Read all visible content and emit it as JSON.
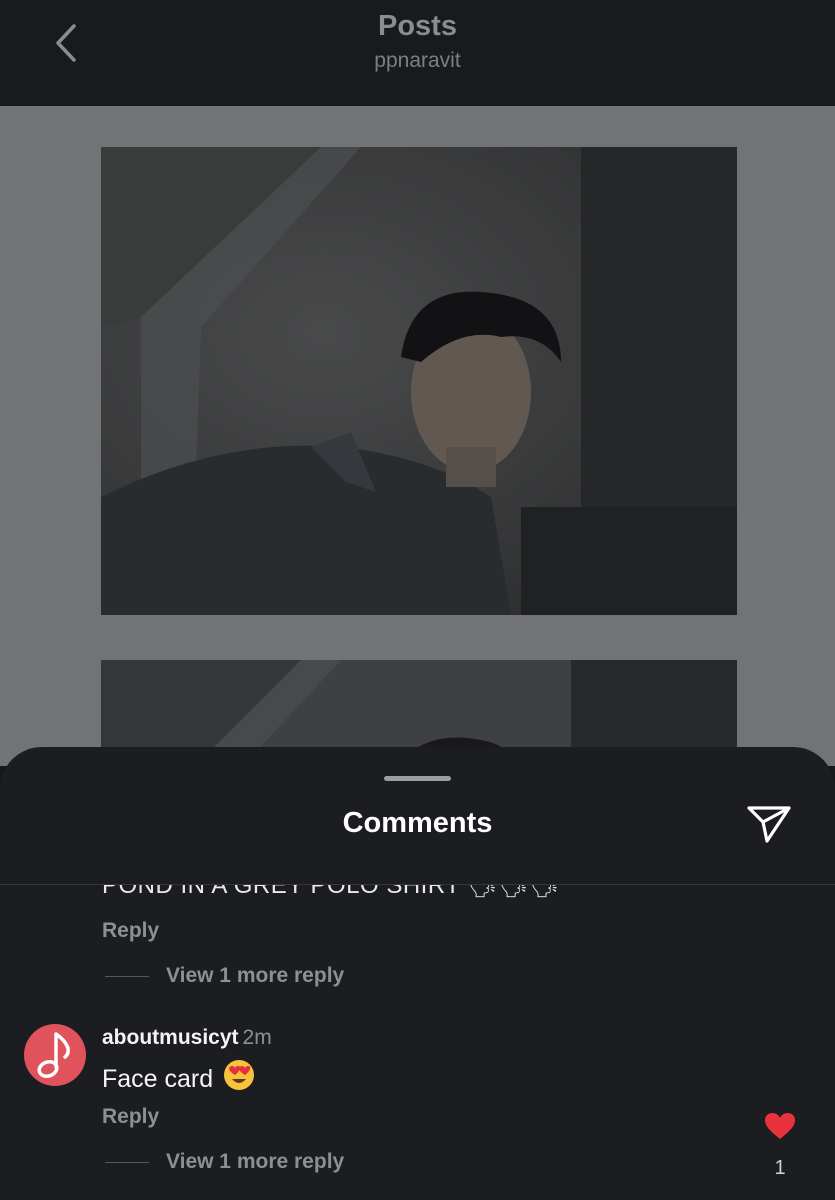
{
  "header": {
    "title": "Posts",
    "subtitle": "ppnaravit",
    "back_icon": "chevron-left-icon"
  },
  "feed": {
    "photos": [
      "post-photo-1",
      "post-photo-2"
    ]
  },
  "sheet": {
    "title": "Comments",
    "share_icon": "paper-plane-icon"
  },
  "comments": [
    {
      "text_partial": "POND IN A GREY POLO SHIRT 🗣🗣🗣",
      "reply_label": "Reply",
      "view_more_label": "View 1 more reply"
    },
    {
      "username": "aboutmusicyt",
      "time": "2m",
      "text": "Face card",
      "emoji": "smiling-face-with-heart-eyes",
      "avatar_icon": "music-note-icon",
      "reply_label": "Reply",
      "view_more_label": "View 1 more reply",
      "like_count": "1",
      "liked": true
    }
  ],
  "colors": {
    "like": "#e8323d",
    "avatar": "#e0525c",
    "sheet_bg": "#1b1d21"
  }
}
